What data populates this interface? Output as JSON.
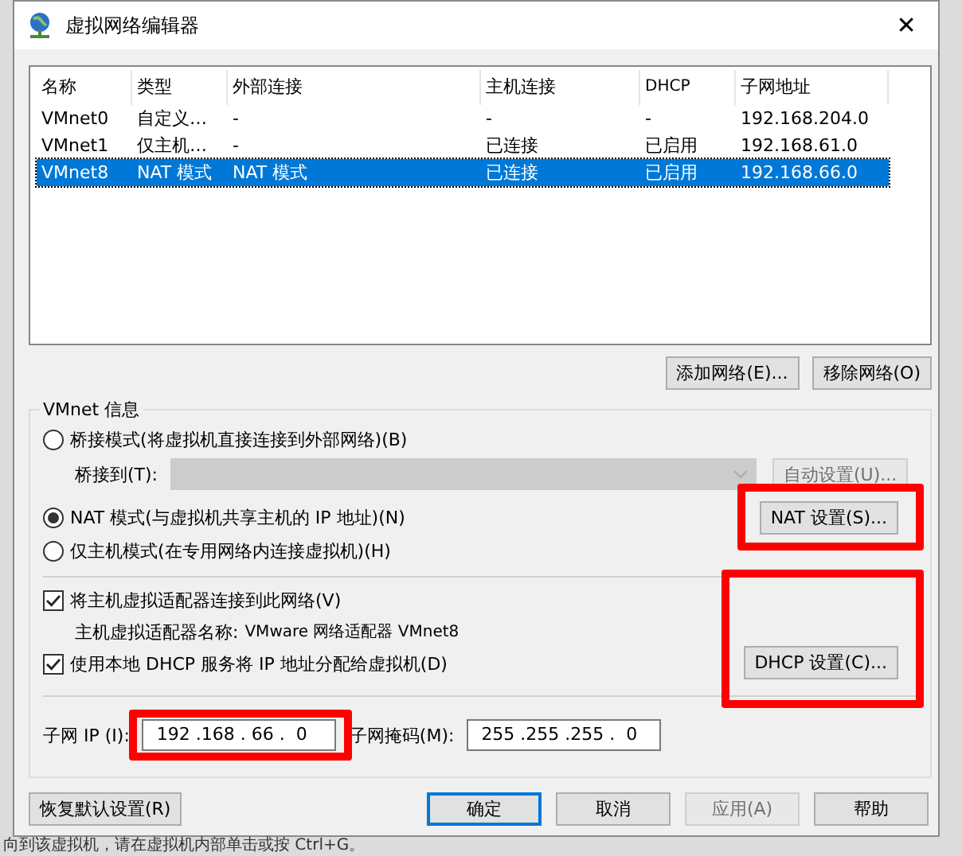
{
  "window": {
    "title": "虚拟网络编辑器",
    "close": "✕"
  },
  "table": {
    "columns": [
      "名称",
      "类型",
      "外部连接",
      "主机连接",
      "DHCP",
      "子网地址"
    ],
    "rows": [
      {
        "cells": [
          "VMnet0",
          "自定义…",
          "-",
          "-",
          "-",
          "192.168.204.0"
        ],
        "selected": false
      },
      {
        "cells": [
          "VMnet1",
          "仅主机…",
          "-",
          "已连接",
          "已启用",
          "192.168.61.0"
        ],
        "selected": false
      },
      {
        "cells": [
          "VMnet8",
          "NAT 模式",
          "NAT 模式",
          "已连接",
          "已启用",
          "192.168.66.0"
        ],
        "selected": true
      }
    ]
  },
  "list_buttons": [
    {
      "label": "添加网络(E)..."
    },
    {
      "label": "移除网络(O)"
    }
  ],
  "vmnet_info": {
    "title": "VMnet 信息",
    "bridged": {
      "label": "桥接模式(将虚拟机直接连接到外部网络)(B)",
      "selected": false
    },
    "bridge_to": {
      "label": "桥接到(T):",
      "disabled": true,
      "button": "自动设置(U)...",
      "button_disabled": true
    },
    "nat": {
      "label": "NAT 模式(与虚拟机共享主机的 IP 地址)(N)",
      "selected": true,
      "button": "NAT 设置(S)...",
      "highlighted": true
    },
    "host_only": {
      "label": "仅主机模式(在专用网络内连接虚拟机)(H)",
      "selected": false
    },
    "connect_adapter": {
      "label": "将主机虚拟适配器连接到此网络(V)",
      "checked": true
    },
    "adapter_name": {
      "label": "主机虚拟适配器名称:",
      "value": "VMware 网络适配器 VMnet8"
    },
    "use_dhcp": {
      "label": "使用本地 DHCP 服务将 IP 地址分配给虚拟机(D)",
      "checked": true,
      "button": "DHCP 设置(C)...",
      "highlighted": true
    },
    "subnet_ip": {
      "label": "子网 IP (I):",
      "value": "192 .168 . 66 .  0",
      "highlighted": true
    },
    "subnet_mask": {
      "label": "子网掩码(M):",
      "value": "255 .255 .255 .  0"
    }
  },
  "footer_buttons": [
    {
      "label": "恢复默认设置(R)",
      "disabled": false,
      "default": false
    },
    {
      "label": "确定",
      "disabled": false,
      "default": true
    },
    {
      "label": "取消",
      "disabled": false,
      "default": false
    },
    {
      "label": "应用(A)",
      "disabled": true,
      "default": false
    },
    {
      "label": "帮助",
      "disabled": false,
      "default": false
    }
  ],
  "background_status": "向到该虚拟机，请在虚拟机内部单击或按 Ctrl+G。"
}
